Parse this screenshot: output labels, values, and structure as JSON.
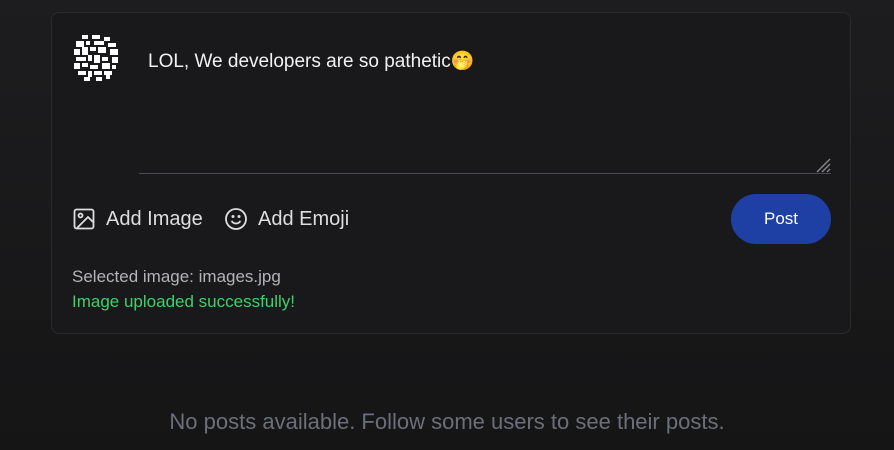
{
  "composer": {
    "text": "LOL, We developers are so pathetic🤭",
    "actions": {
      "add_image_label": "Add Image",
      "add_emoji_label": "Add Emoji"
    },
    "post_label": "Post",
    "selected_image": "Selected image: images.jpg",
    "upload_status": "Image uploaded successfully!"
  },
  "feed": {
    "empty_message": "No posts available. Follow some users to see their posts."
  },
  "colors": {
    "accent": "#1e3fa3",
    "success": "#3ed06a",
    "muted": "#6c6f7a"
  }
}
